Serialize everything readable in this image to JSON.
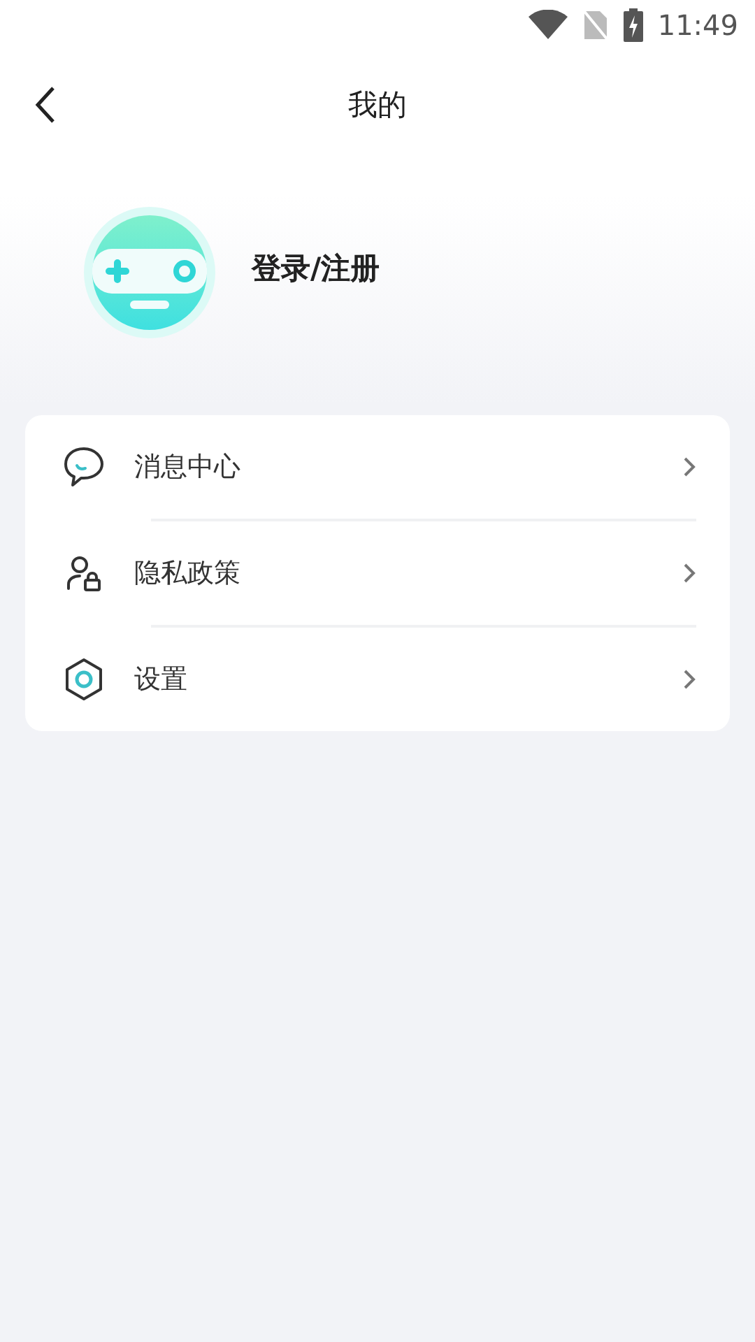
{
  "status_bar": {
    "time": "11:49"
  },
  "header": {
    "title": "我的"
  },
  "profile": {
    "login_label": "登录/注册"
  },
  "menu": [
    {
      "kind": "message",
      "label": "消息中心"
    },
    {
      "kind": "privacy",
      "label": "隐私政策"
    },
    {
      "kind": "settings",
      "label": "设置"
    }
  ]
}
